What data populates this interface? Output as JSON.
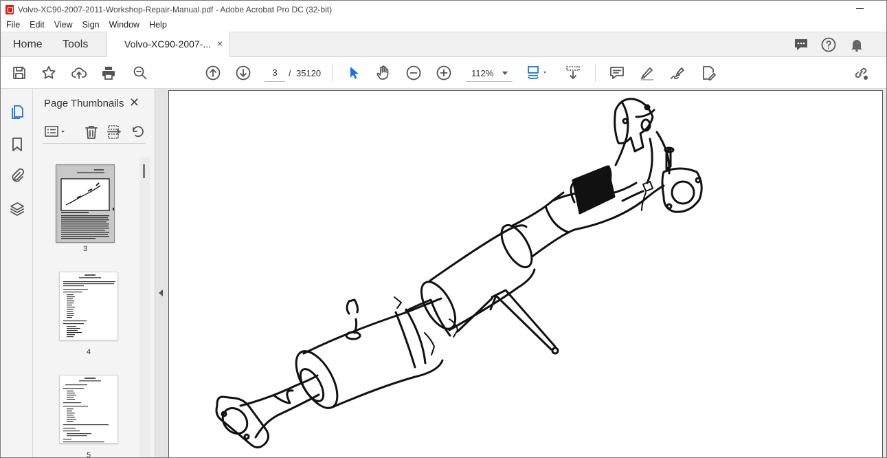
{
  "window": {
    "title": "Volvo-XC90-2007-2011-Workshop-Repair-Manual.pdf - Adobe Acrobat Pro DC (32-bit)"
  },
  "menu": [
    "File",
    "Edit",
    "View",
    "Sign",
    "Window",
    "Help"
  ],
  "tabs": {
    "home": "Home",
    "tools": "Tools",
    "document": "Volvo-XC90-2007-...",
    "close_glyph": "×"
  },
  "toolbar": {
    "current_page": "3",
    "page_separator": "/",
    "total_pages": "35120",
    "zoom": "112%"
  },
  "left_panel": {
    "title": "Page Thumbnails",
    "close_glyph": "✕",
    "thumbnails": [
      {
        "label": "3",
        "selected": true
      },
      {
        "label": "4",
        "selected": false
      },
      {
        "label": "5",
        "selected": false
      }
    ]
  },
  "icons": {
    "toolbar": [
      "save-icon",
      "bookmark-star-icon",
      "upload-icon",
      "print-icon",
      "zoom-search-icon",
      "page-up-icon",
      "page-down-icon",
      "select-cursor-icon",
      "hand-icon",
      "zoom-out-icon",
      "zoom-in-icon",
      "fit-page-icon",
      "scroll-mode-icon",
      "comment-icon",
      "highlight-icon",
      "sign-icon",
      "edit-pdf-icon",
      "share-link-icon"
    ],
    "tabbar_right": [
      "chat-icon",
      "help-icon",
      "bell-icon"
    ],
    "rail": [
      "pages-icon",
      "bookmark-icon",
      "attachment-icon",
      "layers-icon"
    ],
    "panel_tools": [
      "thumbnail-options-icon",
      "delete-icon",
      "insert-page-icon",
      "rotate-icon"
    ]
  },
  "colors": {
    "accent_blue": "#1473e6",
    "acrobat_red": "#d9261c",
    "chrome_gray": "#f0f0f0"
  }
}
